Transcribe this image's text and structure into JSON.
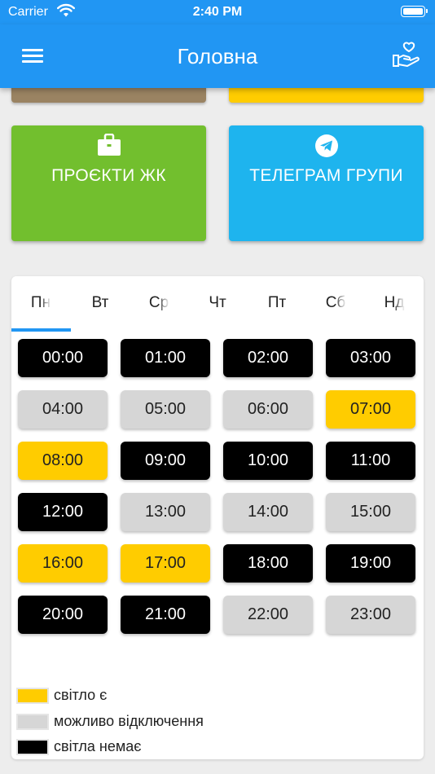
{
  "status_bar": {
    "carrier": "Carrier",
    "time": "2:40 PM"
  },
  "app_bar": {
    "title": "Головна"
  },
  "tiles": [
    {
      "label": "ПРОЄКТИ ЖК",
      "color": "#72bf2e",
      "icon": "briefcase-icon"
    },
    {
      "label": "ТЕЛЕГРАМ ГРУПИ",
      "color": "#1eb4ee",
      "icon": "telegram-icon"
    }
  ],
  "days": [
    "Пн",
    "Вт",
    "Ср",
    "Чт",
    "Пт",
    "Сб",
    "Нд"
  ],
  "selected_day": 0,
  "slots": [
    {
      "time": "00:00",
      "status": "off"
    },
    {
      "time": "01:00",
      "status": "off"
    },
    {
      "time": "02:00",
      "status": "off"
    },
    {
      "time": "03:00",
      "status": "off"
    },
    {
      "time": "04:00",
      "status": "maybe"
    },
    {
      "time": "05:00",
      "status": "maybe"
    },
    {
      "time": "06:00",
      "status": "maybe"
    },
    {
      "time": "07:00",
      "status": "on"
    },
    {
      "time": "08:00",
      "status": "on"
    },
    {
      "time": "09:00",
      "status": "off"
    },
    {
      "time": "10:00",
      "status": "off"
    },
    {
      "time": "11:00",
      "status": "off"
    },
    {
      "time": "12:00",
      "status": "off"
    },
    {
      "time": "13:00",
      "status": "maybe"
    },
    {
      "time": "14:00",
      "status": "maybe"
    },
    {
      "time": "15:00",
      "status": "maybe"
    },
    {
      "time": "16:00",
      "status": "on"
    },
    {
      "time": "17:00",
      "status": "on"
    },
    {
      "time": "18:00",
      "status": "off"
    },
    {
      "time": "19:00",
      "status": "off"
    },
    {
      "time": "20:00",
      "status": "off"
    },
    {
      "time": "21:00",
      "status": "off"
    },
    {
      "time": "22:00",
      "status": "maybe"
    },
    {
      "time": "23:00",
      "status": "maybe"
    }
  ],
  "legend": [
    {
      "label": "світло є",
      "color": "#ffcc00"
    },
    {
      "label": "можливо відключення",
      "color": "#d6d6d6"
    },
    {
      "label": "світла немає",
      "color": "#000000"
    }
  ],
  "colors": {
    "primary": "#2196f3",
    "light_on": "#ffcc00",
    "maybe": "#d6d6d6",
    "light_off": "#000000"
  }
}
